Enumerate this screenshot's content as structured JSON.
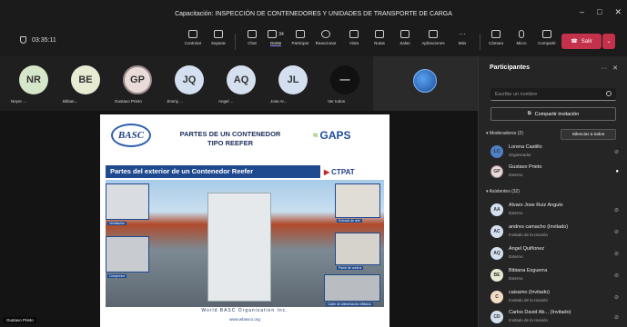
{
  "window": {
    "title": "Capacitación: INSPECCIÓN DE CONTENEDORES Y UNIDADES DE TRANSPORTE DE CARGA"
  },
  "meeting": {
    "elapsed": "03:35:11"
  },
  "toolbar": {
    "controlar": "Controlar",
    "separar": "Separar",
    "chat": "Chat",
    "gente": "Gente",
    "gente_count": "34",
    "participar": "Participar",
    "reaccionar": "Reaccionar",
    "vista": "Vista",
    "notas": "Notas",
    "salas": "Salas",
    "aplicaciones": "Aplicaciones",
    "mas": "Más",
    "camara": "Cámara",
    "micro": "Micro",
    "compartir": "Compartir",
    "salir": "Salir"
  },
  "gallery": [
    {
      "initials": "NR",
      "name": "Neyer ...",
      "color": "#d6e6c9"
    },
    {
      "initials": "BE",
      "name": "Bibian...",
      "color": "#e6ebd2"
    },
    {
      "initials": "GP",
      "name": "Gustavo Prieto",
      "color": "#eadbd8"
    },
    {
      "initials": "JQ",
      "name": "Jimmy ...",
      "color": "#d4e0f0"
    },
    {
      "initials": "AQ",
      "name": "Angel ...",
      "color": "#d4e0f0"
    },
    {
      "initials": "JL",
      "name": "Jose Ar...",
      "color": "#d4e0f0"
    }
  ],
  "gallery_more": {
    "label": "Ver todos",
    "symbol": "—"
  },
  "slide": {
    "brand_left": "BASC",
    "title": "PARTES DE UN CONTENEDOR TIPO REEFER",
    "brand_right": "GAPS",
    "banner": "Partes del exterior de un Contenedor Reefer",
    "ctpat": "CTPAT",
    "labels": [
      "Ventilación",
      "Compresor",
      "Entrada de aire",
      "Panel de control",
      "Cable de alimentación trifásica"
    ],
    "footer": "World BASC Organization Inc.",
    "url": "www.wbasco.org"
  },
  "stage": {
    "presenter": "Gustavo Prieto"
  },
  "panel": {
    "title": "Participantes",
    "search_placeholder": "Escribe un nombre",
    "invite": "Compartir invitación",
    "moderators_label": "Moderadores (2)",
    "silence": "Silenciar a todos",
    "attendees_label": "Asistentes (32)",
    "moderators": [
      {
        "initials": "LC",
        "name": "Lorena Castillo",
        "role": "Organizador",
        "color": "#4e7fc4"
      },
      {
        "initials": "GP",
        "name": "Gustavo Prieto",
        "role": "Externo",
        "color": "#eadbd8"
      }
    ],
    "attendees": [
      {
        "initials": "AA",
        "name": "Alvaro Jose Ruiz Angulo",
        "role": "Externo",
        "color": "#d4e0f0"
      },
      {
        "initials": "AC",
        "name": "andres camacho (Invitado)",
        "role": "Invitado de la reunión",
        "color": "#d4e0f0"
      },
      {
        "initials": "AQ",
        "name": "Angel Quiñonez",
        "role": "Externo",
        "color": "#d4e0f0"
      },
      {
        "initials": "BE",
        "name": "Bibiana Esguerra",
        "role": "Externo",
        "color": "#e6ebd2"
      },
      {
        "initials": "C",
        "name": "caisamo (Invitado)",
        "role": "Invitado de la reunión",
        "color": "#f3dcc4"
      },
      {
        "initials": "CD",
        "name": "Carlos David Ab... (Invitado)",
        "role": "Invitado de la reunión",
        "color": "#d4e0f0"
      }
    ]
  }
}
